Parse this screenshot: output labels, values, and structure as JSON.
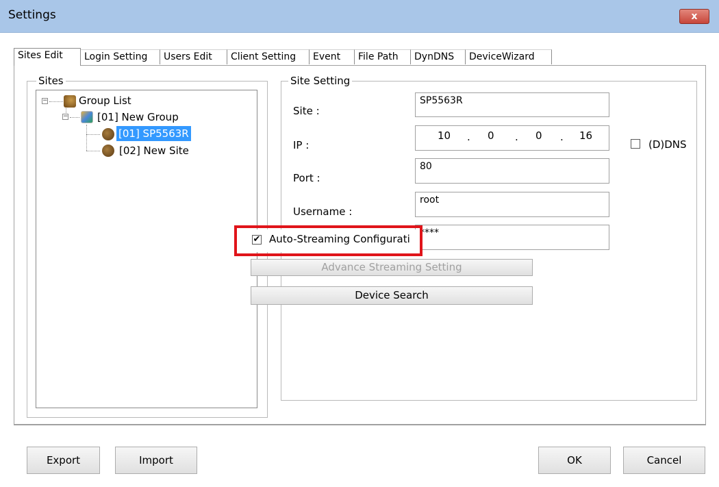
{
  "window": {
    "title": "Settings",
    "close_label": "x"
  },
  "tabs": [
    "Sites Edit",
    "Login Setting",
    "Users Edit",
    "Client Setting",
    "Event",
    "File Path",
    "DynDNS",
    "DeviceWizard"
  ],
  "sites": {
    "legend": "Sites",
    "tree": {
      "root": "Group List",
      "group": "[01] New Group",
      "items": [
        "[01] SP5563R",
        "[02] New Site"
      ]
    }
  },
  "site_setting": {
    "legend": "Site Setting",
    "site_label": "Site :",
    "site_value": "SP5563R",
    "ip_label": "IP :",
    "ip_octets": [
      "10",
      "0",
      "0",
      "16"
    ],
    "ip_dot": ".",
    "ddns_label": "(D)DNS",
    "port_label": "Port :",
    "port_value": "80",
    "username_label": "Username :",
    "username_value": "root",
    "password_value": "****",
    "auto_streaming_label": "Auto-Streaming Configurati",
    "advance_button": "Advance Streaming Setting",
    "device_search_button": "Device Search"
  },
  "footer": {
    "export": "Export",
    "import": "Import",
    "ok": "OK",
    "cancel": "Cancel"
  },
  "colors": {
    "highlight": "#e0141a",
    "selection": "#3399ff",
    "titlebar": "#a9c6e8"
  },
  "icons": {
    "close": "close-icon",
    "checkmark": "checkmark-icon",
    "site": "site-icon",
    "group": "group-icon",
    "expander_minus": "collapse-icon"
  }
}
